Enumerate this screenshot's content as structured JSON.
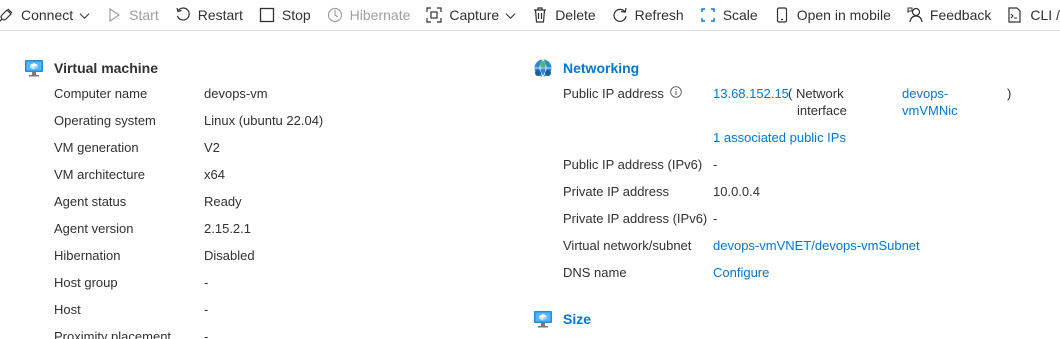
{
  "toolbar": {
    "connect": "Connect",
    "start": "Start",
    "restart": "Restart",
    "stop": "Stop",
    "hibernate": "Hibernate",
    "capture": "Capture",
    "delete": "Delete",
    "refresh": "Refresh",
    "scale": "Scale",
    "open_mobile": "Open in mobile",
    "feedback": "Feedback",
    "cli": "CLI / PS"
  },
  "vm": {
    "title": "Virtual machine",
    "rows": [
      {
        "label": "Computer name",
        "value": "devops-vm"
      },
      {
        "label": "Operating system",
        "value": "Linux (ubuntu 22.04)"
      },
      {
        "label": "VM generation",
        "value": "V2"
      },
      {
        "label": "VM architecture",
        "value": "x64"
      },
      {
        "label": "Agent status",
        "value": "Ready"
      },
      {
        "label": "Agent version",
        "value": "2.15.2.1"
      },
      {
        "label": "Hibernation",
        "value": "Disabled"
      },
      {
        "label": "Host group",
        "value": "-"
      },
      {
        "label": "Host",
        "value": "-"
      },
      {
        "label": "Proximity placement",
        "value": "-"
      }
    ]
  },
  "networking": {
    "title": "Networking",
    "public_ip_label": "Public IP address",
    "public_ip": "13.68.152.15",
    "nic_open": "( Network",
    "nic_word": "interface",
    "nic_link_1": "devops-",
    "nic_link_2": "vmVMNic",
    "nic_close": ")",
    "assoc_ips": "1 associated public IPs",
    "rows": [
      {
        "label": "Public IP address (IPv6)",
        "value": "-"
      },
      {
        "label": "Private IP address",
        "value": "10.0.0.4"
      },
      {
        "label": "Private IP address (IPv6)",
        "value": "-"
      },
      {
        "label": "Virtual network/subnet",
        "value": "devops-vmVNET/devops-vmSubnet"
      },
      {
        "label": "DNS name",
        "value": "Configure"
      }
    ]
  },
  "size": {
    "title": "Size"
  },
  "colors": {
    "accent": "#0078d4",
    "text": "#323130",
    "disabled": "#a19f9d"
  }
}
